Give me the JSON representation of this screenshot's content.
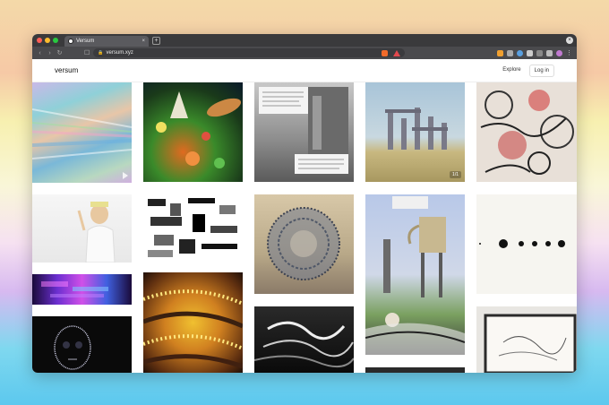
{
  "browser": {
    "tab_title": "Versum",
    "tab_close": "×",
    "new_tab": "+",
    "window_close": "×",
    "url": "versum.xyz",
    "back": "‹",
    "forward": "›",
    "reload": "↻",
    "bookmark": "☐",
    "lock": "🔒",
    "menu": "⋮"
  },
  "site": {
    "logo": "versum",
    "nav": {
      "explore": "Explore",
      "login": "Log in"
    }
  },
  "gallery": {
    "tiles": [
      {
        "name": "artwork-holographic",
        "play": true
      },
      {
        "name": "artwork-forest-creatures"
      },
      {
        "name": "artwork-street-text-collage"
      },
      {
        "name": "artwork-ruins-desert",
        "badge": "1/1"
      },
      {
        "name": "artwork-ink-faces"
      },
      {
        "name": "artwork-white-figure"
      },
      {
        "name": "artwork-pixel-noise"
      },
      {
        "name": "artwork-orb-sculpture"
      },
      {
        "name": "artwork-teapot-tower"
      },
      {
        "name": "artwork-dots-minimal"
      },
      {
        "name": "artwork-purple-glitch"
      },
      {
        "name": "artwork-yellow-dots-warp"
      },
      {
        "name": "artwork-skull-glitch"
      },
      {
        "name": "artwork-mono-waves"
      },
      {
        "name": "artwork-framed-sketch"
      }
    ]
  },
  "colors": {
    "chrome_dark": "#3a3a3c",
    "toolbar": "#4a4a4d",
    "close_red": "#ff5f57",
    "min_yellow": "#febc2e",
    "max_green": "#28c840"
  }
}
